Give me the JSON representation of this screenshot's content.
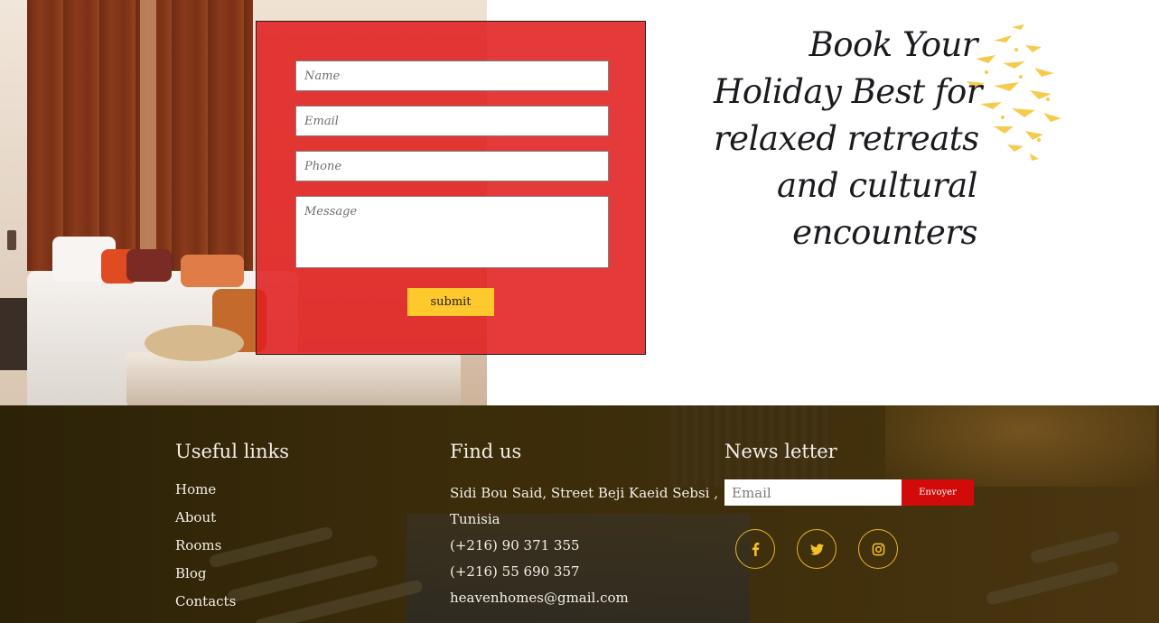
{
  "booking_form": {
    "name_placeholder": "Name",
    "email_placeholder": "Email",
    "phone_placeholder": "Phone",
    "message_placeholder": "Message",
    "submit_label": "submit"
  },
  "headline": {
    "lines": [
      "Book Your",
      "Holiday Best for",
      "relaxed retreats",
      "and cultural",
      "encounters"
    ]
  },
  "footer": {
    "useful_links": {
      "title": "Useful links",
      "items": [
        "Home",
        "About",
        "Rooms",
        "Blog",
        "Contacts"
      ]
    },
    "find_us": {
      "title": "Find us",
      "address_line1": "Sidi Bou Said, Street Beji Kaeid Sebsi ,",
      "address_line2": "Tunisia",
      "phone1": "(+216) 90 371 355",
      "phone2": "(+216) 55 690 357",
      "email": "heavenhomes@gmail.com"
    },
    "newsletter": {
      "title": "News letter",
      "email_placeholder": "Email",
      "button_label": "Envoyer"
    },
    "social_icons": [
      "facebook-icon",
      "twitter-icon",
      "instagram-icon"
    ]
  },
  "colors": {
    "form_red": "#e01f1f",
    "accent_yellow": "#ffc92e",
    "newsletter_red": "#d20a0a",
    "footer_dark": "#3a2b0a"
  }
}
